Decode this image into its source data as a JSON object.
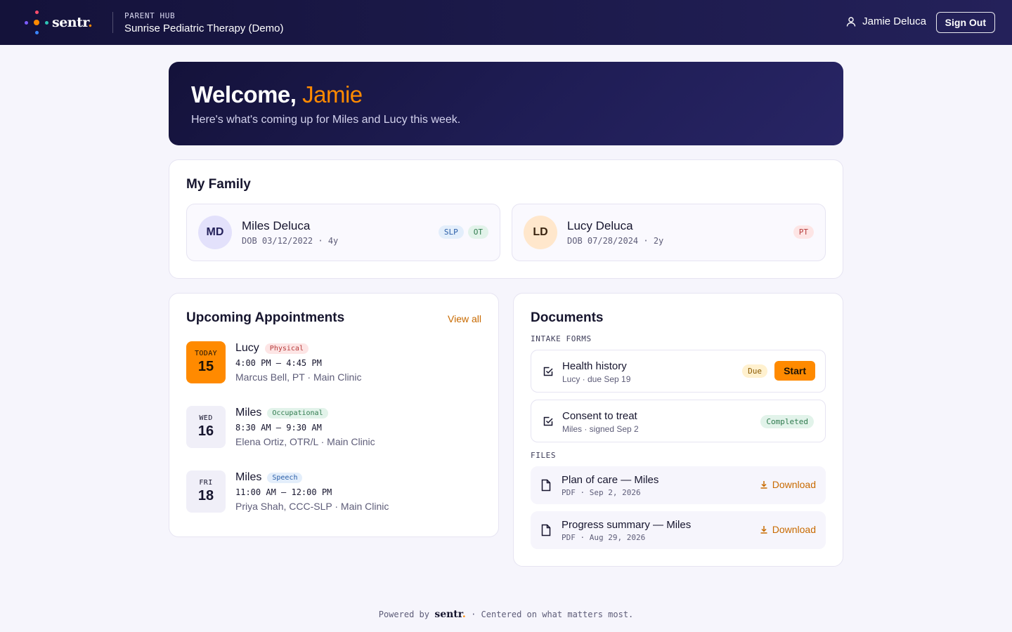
{
  "header": {
    "brand_word": "sentr",
    "brand_accent": ".",
    "eyebrow": "PARENT HUB",
    "clinic_name": "Sunrise Pediatric Therapy (Demo)",
    "user_name": "Jamie Deluca",
    "user_icon": "user-icon",
    "signout_label": "Sign Out"
  },
  "hero": {
    "greeting": "Welcome,",
    "name": "Jamie",
    "subtitle": "Here's what's coming up for Miles and Lucy this week."
  },
  "family": {
    "title": "My Family",
    "children": [
      {
        "initials": "MD",
        "name": "Miles Deluca",
        "dob": "DOB 03/12/2022 · 4y",
        "tags": [
          "SLP",
          "OT"
        ]
      },
      {
        "initials": "LD",
        "name": "Lucy Deluca",
        "dob": "DOB 07/28/2024 · 2y",
        "tags": [
          "PT"
        ]
      }
    ]
  },
  "appointments": {
    "title": "Upcoming Appointments",
    "view_all": "View all",
    "items": [
      {
        "dow": "TODAY",
        "day": "15",
        "child": "Lucy",
        "type": "Physical",
        "time": "4:00 PM – 4:45 PM",
        "provider": "Marcus Bell, PT · Main Clinic"
      },
      {
        "dow": "WED",
        "day": "16",
        "child": "Miles",
        "type": "Occupational",
        "time": "8:30 AM – 9:30 AM",
        "provider": "Elena Ortiz, OTR/L · Main Clinic"
      },
      {
        "dow": "FRI",
        "day": "18",
        "child": "Miles",
        "type": "Speech",
        "time": "11:00 AM – 12:00 PM",
        "provider": "Priya Shah, CCC-SLP · Main Clinic"
      }
    ]
  },
  "documents": {
    "title": "Documents",
    "intake_label": "INTAKE FORMS",
    "forms": [
      {
        "title": "Health history",
        "meta": "Lucy · due Sep 19",
        "status": "Due",
        "action": "Start"
      },
      {
        "title": "Consent to treat",
        "meta": "Miles · signed Sep 2",
        "status": "Completed"
      }
    ],
    "files_label": "FILES",
    "files": [
      {
        "title": "Plan of care — Miles",
        "meta": "PDF · Sep 2, 2026",
        "action": "Download"
      },
      {
        "title": "Progress summary — Miles",
        "meta": "PDF · Aug 29, 2026",
        "action": "Download"
      }
    ]
  },
  "footer": {
    "powered_by": "Powered by",
    "brand_word": "sentr",
    "brand_accent": ".",
    "tagline": "· Centered on what matters most."
  },
  "colors": {
    "accent": "#ff8a00",
    "navy": "#14123a",
    "background": "#f6f5fc"
  }
}
